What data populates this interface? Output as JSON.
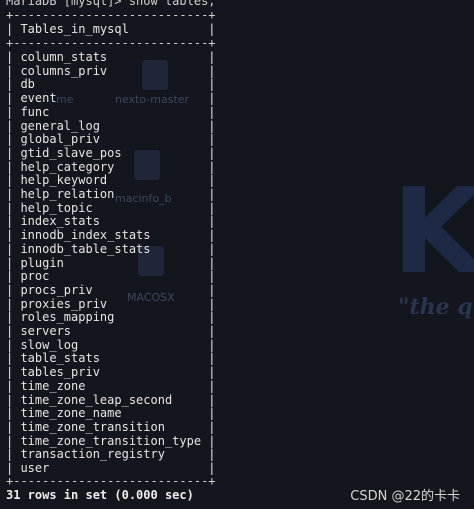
{
  "terminal": {
    "prompt_line": "MariaDB [mysql]> show tables;",
    "table_border": "+---------------------------+",
    "header_row": "| Tables_in_mysql           |",
    "rows": [
      "| column_stats              |",
      "| columns_priv              |",
      "| db                        |",
      "| event                     |",
      "| func                      |",
      "| general_log               |",
      "| global_priv               |",
      "| gtid_slave_pos            |",
      "| help_category             |",
      "| help_keyword              |",
      "| help_relation             |",
      "| help_topic                |",
      "| index_stats               |",
      "| innodb_index_stats        |",
      "| innodb_table_stats        |",
      "| plugin                    |",
      "| proc                      |",
      "| procs_priv                |",
      "| proxies_priv              |",
      "| roles_mapping             |",
      "| servers                   |",
      "| slow_log                  |",
      "| table_stats               |",
      "| tables_priv               |",
      "| time_zone                 |",
      "| time_zone_leap_second     |",
      "| time_zone_name            |",
      "| time_zone_transition      |",
      "| time_zone_transition_type |",
      "| transaction_registry      |",
      "| user                      |"
    ],
    "summary": "31 rows in set (0.000 sec)"
  },
  "wallpaper": {
    "labels": [
      "me",
      "nexto-master",
      "macinfo_b",
      "MACOSX"
    ],
    "big_letter": "K",
    "quote": "\"the q"
  },
  "watermark": "CSDN @22的卡卡"
}
